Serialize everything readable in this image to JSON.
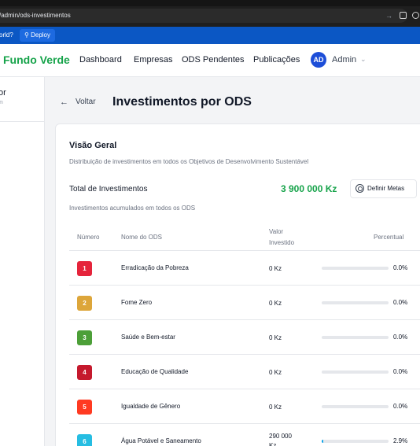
{
  "browser": {
    "url": "/admin/ods-investimentos"
  },
  "bookmarks": {
    "world": "orld?",
    "deploy": "Deploy"
  },
  "nav": {
    "brand": "Fundo Verde",
    "links": [
      "Dashboard",
      "Empresas",
      "ODS Pendentes",
      "Publicações"
    ],
    "avatar_initials": "AD",
    "user": "Admin"
  },
  "sidebar": {
    "title": "or",
    "subtitle": "m"
  },
  "page": {
    "back": "Voltar",
    "title": "Investimentos por ODS"
  },
  "overview": {
    "title": "Visão Geral",
    "description": "Distribuição de investimentos em todos os Objetivos de Desenvolvimento Sustentável",
    "total_label": "Total de Investimentos",
    "total_value": "3 900 000 Kz",
    "goal_button": "Definir Metas",
    "total_sub": "Investimentos acumulados em todos os ODS"
  },
  "table": {
    "headers": {
      "number": "Número",
      "name": "Nome do ODS",
      "value_line1": "Valor",
      "value_line2": "Investido",
      "percent": "Percentual"
    },
    "rows": [
      {
        "num": "1",
        "name": "Erradicação da Pobreza",
        "value": "0 Kz",
        "value2": "",
        "pct": "0.0%",
        "frac": 0.0,
        "color": "#e5243b"
      },
      {
        "num": "2",
        "name": "Fome Zero",
        "value": "0 Kz",
        "value2": "",
        "pct": "0.0%",
        "frac": 0.0,
        "color": "#dda63a"
      },
      {
        "num": "3",
        "name": "Saúde e Bem-estar",
        "value": "0 Kz",
        "value2": "",
        "pct": "0.0%",
        "frac": 0.0,
        "color": "#4c9f38"
      },
      {
        "num": "4",
        "name": "Educação de Qualidade",
        "value": "0 Kz",
        "value2": "",
        "pct": "0.0%",
        "frac": 0.0,
        "color": "#c5192d"
      },
      {
        "num": "5",
        "name": "Igualdade de Gênero",
        "value": "0 Kz",
        "value2": "",
        "pct": "0.0%",
        "frac": 0.0,
        "color": "#ff3a21"
      },
      {
        "num": "6",
        "name": "Água Potável e Saneamento",
        "value": "290 000",
        "value2": "Kz",
        "pct": "2.9%",
        "frac": 0.029,
        "color": "#26bde2"
      }
    ]
  }
}
